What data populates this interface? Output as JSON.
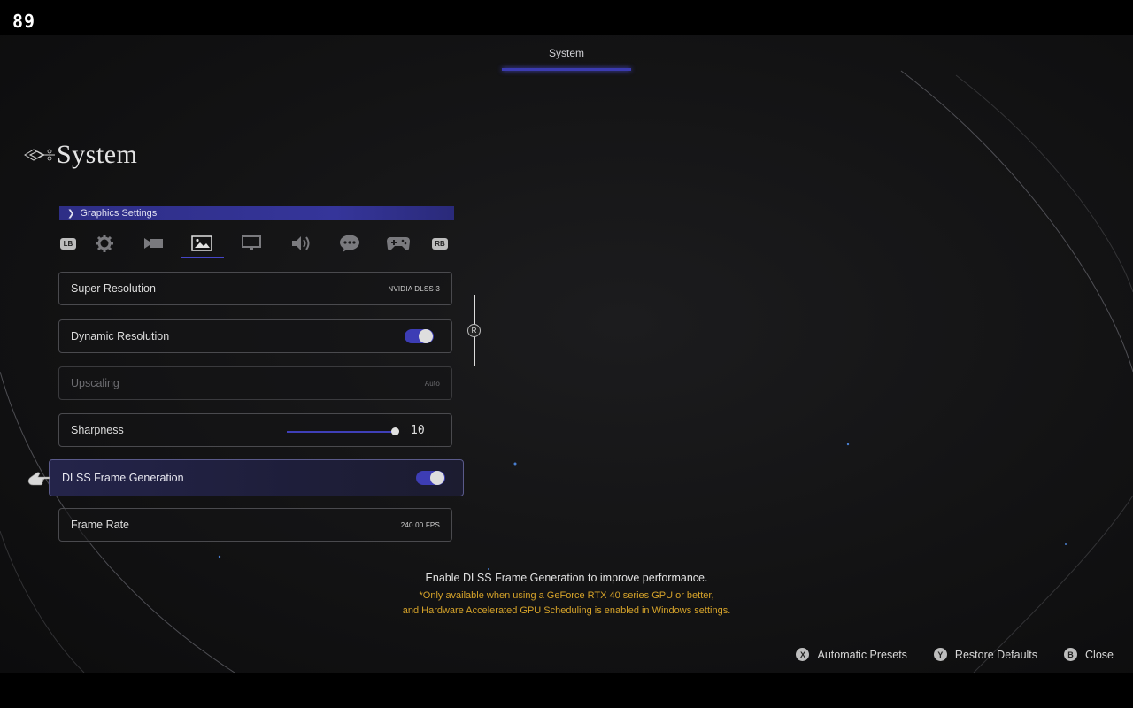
{
  "hud": {
    "fps_counter": "89"
  },
  "top_nav": {
    "active_tab": "System"
  },
  "page": {
    "title": "System"
  },
  "category": {
    "label": "Graphics Settings"
  },
  "category_tabs": {
    "left_shoulder": "LB",
    "right_shoulder": "RB",
    "icons": [
      "gear-icon",
      "camera-icon",
      "image-icon",
      "monitor-icon",
      "speaker-icon",
      "chat-icon",
      "gamepad-icon"
    ],
    "active_index": 2
  },
  "settings": [
    {
      "label": "Super Resolution",
      "type": "value",
      "value": "NVIDIA DLSS 3",
      "state": "normal"
    },
    {
      "label": "Dynamic Resolution",
      "type": "toggle",
      "on": true,
      "state": "normal"
    },
    {
      "label": "Upscaling",
      "type": "value",
      "value": "Auto",
      "state": "disabled"
    },
    {
      "label": "Sharpness",
      "type": "slider",
      "value": "10",
      "fraction": 1.0,
      "state": "normal"
    },
    {
      "label": "DLSS Frame Generation",
      "type": "toggle",
      "on": true,
      "state": "selected"
    },
    {
      "label": "Frame Rate",
      "type": "value",
      "value": "240.00 FPS",
      "state": "normal"
    }
  ],
  "scroll_hint": "R",
  "description": {
    "main": "Enable DLSS Frame Generation to improve performance.",
    "note_line1": "*Only available when using a GeForce RTX 40 series GPU or better,",
    "note_line2": "and Hardware Accelerated GPU Scheduling is enabled in Windows settings."
  },
  "footer": {
    "presets": {
      "glyph": "X",
      "label": "Automatic Presets"
    },
    "restore": {
      "glyph": "Y",
      "label": "Restore Defaults"
    },
    "close": {
      "glyph": "B",
      "label": "Close"
    }
  },
  "colors": {
    "accent": "#3d3db5",
    "note": "#d6a32a",
    "background": "#131314"
  }
}
